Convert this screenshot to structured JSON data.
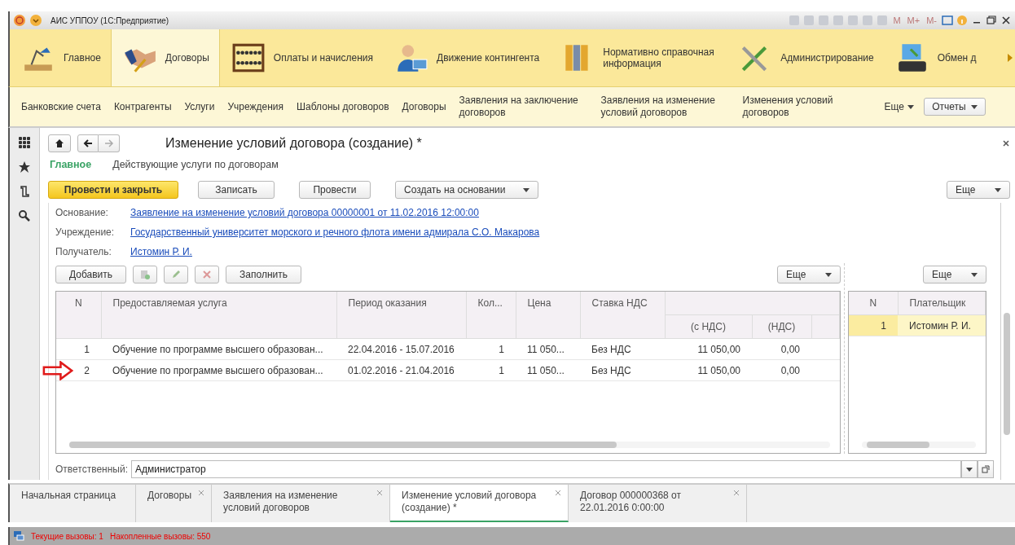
{
  "window": {
    "title": "АИС УППОУ (1С:Предприятие)",
    "toolbar_buttons": [
      "M",
      "M+",
      "M-"
    ]
  },
  "sections": [
    {
      "label": "Главное",
      "selected": false
    },
    {
      "label": "Договоры",
      "selected": true
    },
    {
      "label": "Оплаты и начисления",
      "selected": false
    },
    {
      "label": "Движение контингента",
      "selected": false
    },
    {
      "label": "Нормативно справочная информация",
      "selected": false
    },
    {
      "label": "Администрирование",
      "selected": false
    },
    {
      "label": "Обмен д",
      "selected": false
    }
  ],
  "subnav": {
    "links": [
      "Банковские счета",
      "Контрагенты",
      "Услуги",
      "Учреждения",
      "Шаблоны договоров",
      "Договоры",
      "Заявления на заключение договоров",
      "Заявления на изменение условий договоров",
      "Изменения условий договоров"
    ],
    "more": "Еще",
    "reports": "Отчеты"
  },
  "form": {
    "title": "Изменение условий договора (создание) *",
    "form_tabs": [
      {
        "label": "Главное",
        "selected": true
      },
      {
        "label": "Действующие услуги по договорам",
        "selected": false
      }
    ],
    "buttons": [
      {
        "label": "Провести и закрыть",
        "kind": "primary"
      },
      {
        "label": "Записать",
        "kind": "plain"
      },
      {
        "label": "Провести",
        "kind": "plain"
      },
      {
        "label": "Создать на основании",
        "kind": "dropdown"
      }
    ],
    "more": "Еще",
    "fields": [
      {
        "label": "Основание:",
        "value": "Заявление на изменение условий договора 00000001 от 11.02.2016 12:00:00"
      },
      {
        "label": "Учреждение:",
        "value": "Государственный университет морского и речного флота имени адмирала С.О. Макарова"
      },
      {
        "label": "Получатель:",
        "value": "Истомин Р. И."
      }
    ],
    "table_toolbar": {
      "add": "Добавить",
      "fill": "Заполнить",
      "more": "Еще"
    },
    "services_table": {
      "columns": [
        "N",
        "Предоставляемая услуга",
        "Период оказания",
        "Кол...",
        "Цена",
        "Ставка НДС"
      ],
      "sub_columns": [
        "(с НДС)",
        "(НДС)"
      ],
      "rows": [
        {
          "n": "1",
          "service": "Обучение по программе высшего образован...",
          "period": "22.04.2016 - 15.07.2016",
          "qty": "1",
          "price": "11 050...",
          "vat_rate": "Без НДС",
          "amount": "11 050,00",
          "vat": "0,00",
          "marked": false
        },
        {
          "n": "2",
          "service": "Обучение по программе высшего образован...",
          "period": "01.02.2016 - 21.04.2016",
          "qty": "1",
          "price": "11 050...",
          "vat_rate": "Без НДС",
          "amount": "11 050,00",
          "vat": "0,00",
          "marked": true
        }
      ]
    },
    "payers_more": "Еще",
    "payers_table": {
      "columns": [
        "N",
        "Плательщик"
      ],
      "rows": [
        {
          "n": "1",
          "payer": "Истомин Р. И.",
          "selected": true
        }
      ]
    },
    "responsible": {
      "label": "Ответственный:",
      "value": "Администратор"
    }
  },
  "open_tabs": [
    {
      "label": "Начальная страница",
      "closable": false,
      "selected": false
    },
    {
      "label": "Договоры",
      "closable": true,
      "selected": false
    },
    {
      "label": "Заявления на изменение условий договоров",
      "closable": true,
      "selected": false
    },
    {
      "label": "Изменение условий договора (создание) *",
      "closable": true,
      "selected": true
    },
    {
      "label": "Договор 000000368 от 22.01.2016 0:00:00",
      "closable": true,
      "selected": false
    }
  ],
  "status_bar": {
    "current": "Текущие вызовы: 1",
    "accumulated": "Накопленные вызовы: 550"
  }
}
